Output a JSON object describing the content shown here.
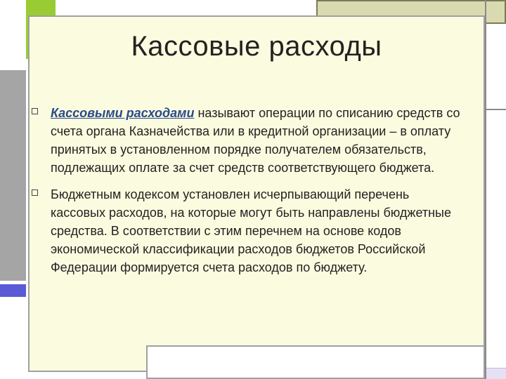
{
  "slide": {
    "title": "Кассовые расходы",
    "bullets": [
      {
        "term": "Кассовыми расходами",
        "text": " называют операции по списанию средств со счета органа Казначейства или в кредитной организации – в оплату принятых в установленном порядке получателем обязательств, подлежащих оплате за счет средств соответствующего бюджета."
      },
      {
        "term": "",
        "text": "Бюджетным кодексом установлен исчерпывающий перечень кассовых расходов, на которые могут быть направлены бюджетные средства. В соответствии с этим перечнем на основе кодов экономической классификации расходов бюджетов Российской Федерации формируется счета расходов по бюджету."
      }
    ]
  },
  "colors": {
    "panel": "#fbfbe0",
    "accent_green": "#99cc33",
    "accent_blue": "#5b5bd6",
    "term_color": "#2a4a8a"
  }
}
